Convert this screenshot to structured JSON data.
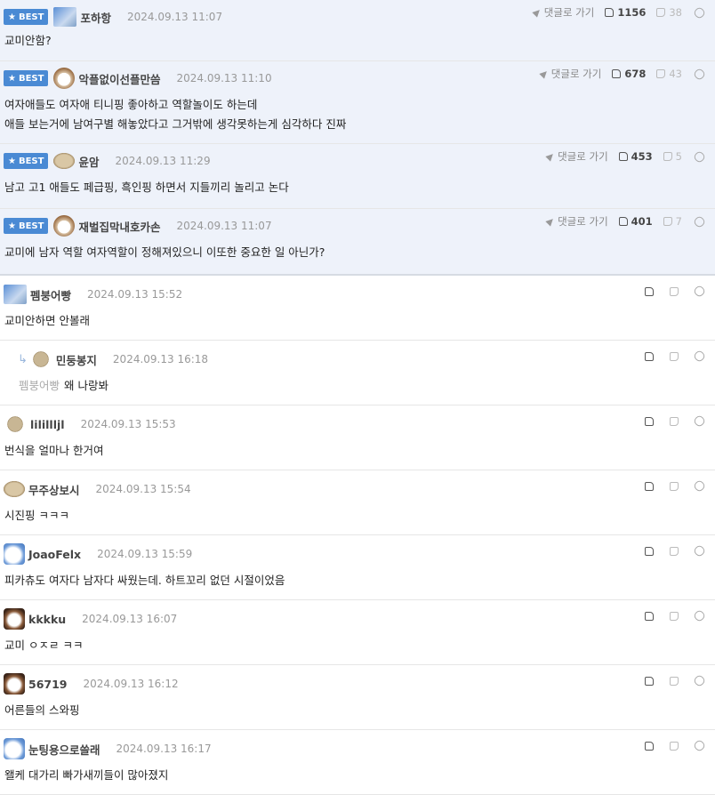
{
  "best_label": "BEST",
  "goto_label": "댓글로 가기",
  "best_comments": [
    {
      "nick": "포하항",
      "date": "2024.09.13 11:07",
      "lines": [
        "교미안함?"
      ],
      "up": "1156",
      "down": "38"
    },
    {
      "nick": "악플없이선플만씀",
      "date": "2024.09.13 11:10",
      "lines": [
        "여자애들도 여자애 티니핑 좋아하고 역할놀이도 하는데",
        "애들 보는거에 남여구별 해놓았다고 그거밖에 생각못하는게 심각하다 진짜"
      ],
      "up": "678",
      "down": "43"
    },
    {
      "nick": "윤암",
      "date": "2024.09.13 11:29",
      "lines": [
        "남고 고1 애들도 페급핑, 흑인핑 하면서 지들끼리 놀리고 논다"
      ],
      "up": "453",
      "down": "5"
    },
    {
      "nick": "재벌집막내호카손",
      "date": "2024.09.13 11:07",
      "lines": [
        "교미에 남자 역할 여자역할이 정해져있으니 이또한 중요한 일 아닌가?"
      ],
      "up": "401",
      "down": "7"
    }
  ],
  "comments": [
    {
      "nick": "펨붕어빵",
      "date": "2024.09.13 15:52",
      "text": "교미안하면 안볼래"
    },
    {
      "nick": "민둥봉지",
      "date": "2024.09.13 16:18",
      "mention": "펨붕어빵",
      "text": "왜 나랑봐"
    },
    {
      "nick": "lilillljl",
      "date": "2024.09.13 15:53",
      "text": "번식을 얼마나 한거여"
    },
    {
      "nick": "무주상보시",
      "date": "2024.09.13 15:54",
      "text": "시진핑 ㅋㅋㅋ"
    },
    {
      "nick": "JoaoFelx",
      "date": "2024.09.13 15:59",
      "text": "피카츄도 여자다 남자다 싸웠는데. 하트꼬리 없던 시절이었음"
    },
    {
      "nick": "kkkku",
      "date": "2024.09.13 16:07",
      "text": "교미 ㅇㅈㄹ ㅋㅋ"
    },
    {
      "nick": "56719",
      "date": "2024.09.13 16:12",
      "text": "어른들의 스와핑"
    },
    {
      "nick": "눈팅용으로쓸래",
      "date": "2024.09.13 16:17",
      "text": "왤케 대가리 빠가새끼들이 많아졌지"
    }
  ]
}
